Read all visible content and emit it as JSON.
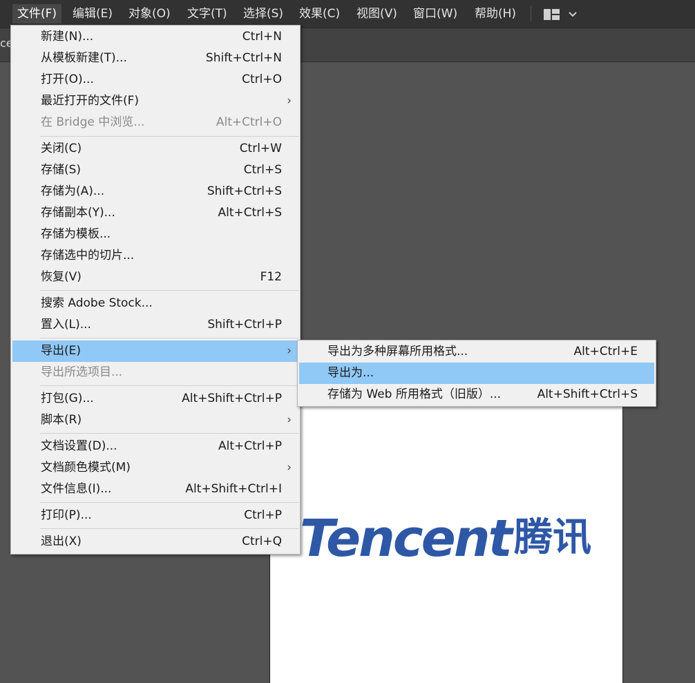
{
  "menubar": {
    "items": [
      "文件(F)",
      "编辑(E)",
      "对象(O)",
      "文字(T)",
      "选择(S)",
      "效果(C)",
      "视图(V)",
      "窗口(W)",
      "帮助(H)"
    ],
    "workspace_icon": "layout-grid-icon",
    "dropdown_icon": "chevron-down-icon"
  },
  "document": {
    "tab_text": "ce"
  },
  "file_menu": {
    "items": [
      {
        "label": "新建(N)...",
        "shortcut": "Ctrl+N"
      },
      {
        "label": "从模板新建(T)...",
        "shortcut": "Shift+Ctrl+N"
      },
      {
        "label": "打开(O)...",
        "shortcut": "Ctrl+O"
      },
      {
        "label": "最近打开的文件(F)",
        "shortcut": "",
        "submenu": "›"
      },
      {
        "label": "在 Bridge 中浏览...",
        "shortcut": "Alt+Ctrl+O",
        "disabled": true
      },
      {
        "label": "关闭(C)",
        "shortcut": "Ctrl+W"
      },
      {
        "label": "存储(S)",
        "shortcut": "Ctrl+S"
      },
      {
        "label": "存储为(A)...",
        "shortcut": "Shift+Ctrl+S"
      },
      {
        "label": "存储副本(Y)...",
        "shortcut": "Alt+Ctrl+S"
      },
      {
        "label": "存储为模板...",
        "shortcut": ""
      },
      {
        "label": "存储选中的切片...",
        "shortcut": ""
      },
      {
        "label": "恢复(V)",
        "shortcut": "F12"
      },
      {
        "label": "搜索 Adobe Stock...",
        "shortcut": ""
      },
      {
        "label": "置入(L)...",
        "shortcut": "Shift+Ctrl+P"
      },
      {
        "label": "导出(E)",
        "shortcut": "",
        "submenu": "›",
        "highlighted": true
      },
      {
        "label": "导出所选项目...",
        "shortcut": "",
        "disabled": true
      },
      {
        "label": "打包(G)...",
        "shortcut": "Alt+Shift+Ctrl+P"
      },
      {
        "label": "脚本(R)",
        "shortcut": "",
        "submenu": "›"
      },
      {
        "label": "文档设置(D)...",
        "shortcut": "Alt+Ctrl+P"
      },
      {
        "label": "文档颜色模式(M)",
        "shortcut": "",
        "submenu": "›"
      },
      {
        "label": "文件信息(I)...",
        "shortcut": "Alt+Shift+Ctrl+I"
      },
      {
        "label": "打印(P)...",
        "shortcut": "Ctrl+P"
      },
      {
        "label": "退出(X)",
        "shortcut": "Ctrl+Q"
      }
    ]
  },
  "export_submenu": {
    "items": [
      {
        "label": "导出为多种屏幕所用格式...",
        "shortcut": "Alt+Ctrl+E"
      },
      {
        "label": "导出为...",
        "shortcut": "",
        "highlighted": true
      },
      {
        "label": "存储为 Web 所用格式（旧版）...",
        "shortcut": "Alt+Shift+Ctrl+S"
      }
    ]
  },
  "artwork": {
    "logo_en": "Tencent",
    "logo_cn": "腾讯",
    "logo_color": "#2e58a6"
  },
  "colors": {
    "menubar_bg": "#323232",
    "menu_bg": "#f0f0f0",
    "highlight": "#90c8f6",
    "canvas_bg": "#535353"
  }
}
